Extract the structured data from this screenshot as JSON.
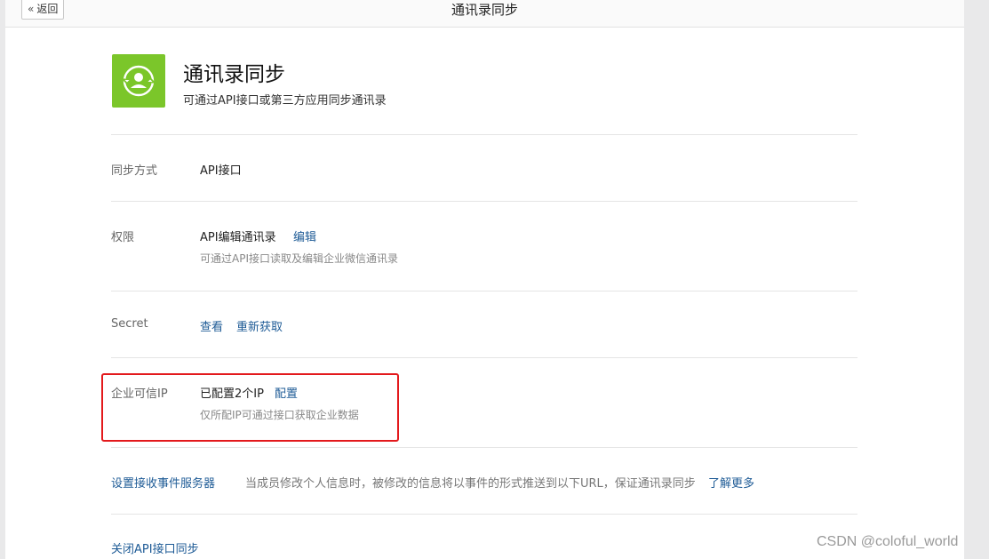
{
  "topbar": {
    "back_label": "返回",
    "title": "通讯录同步"
  },
  "app": {
    "icon": "contacts-sync-icon",
    "icon_color": "#7bc62a",
    "title": "通讯录同步",
    "description": "可通过API接口或第三方应用同步通讯录"
  },
  "settings": {
    "sync_method": {
      "label": "同步方式",
      "value": "API接口"
    },
    "permission": {
      "label": "权限",
      "value": "API编辑通讯录",
      "edit_link": "编辑",
      "note": "可通过API接口读取及编辑企业微信通讯录"
    },
    "secret": {
      "label": "Secret",
      "view_link": "查看",
      "refresh_link": "重新获取"
    },
    "trusted_ip": {
      "label": "企业可信IP",
      "value": "已配置2个IP",
      "config_link": "配置",
      "note": "仅所配IP可通过接口获取企业数据"
    },
    "event_server": {
      "link": "设置接收事件服务器",
      "description": "当成员修改个人信息时，被修改的信息将以事件的形式推送到以下URL，保证通讯录同步",
      "learn_more": "了解更多"
    },
    "close_api": {
      "link": "关闭API接口同步"
    }
  },
  "colors": {
    "link": "#1e5b96",
    "highlight": "#e3191c"
  },
  "watermark": "CSDN @coloful_world"
}
